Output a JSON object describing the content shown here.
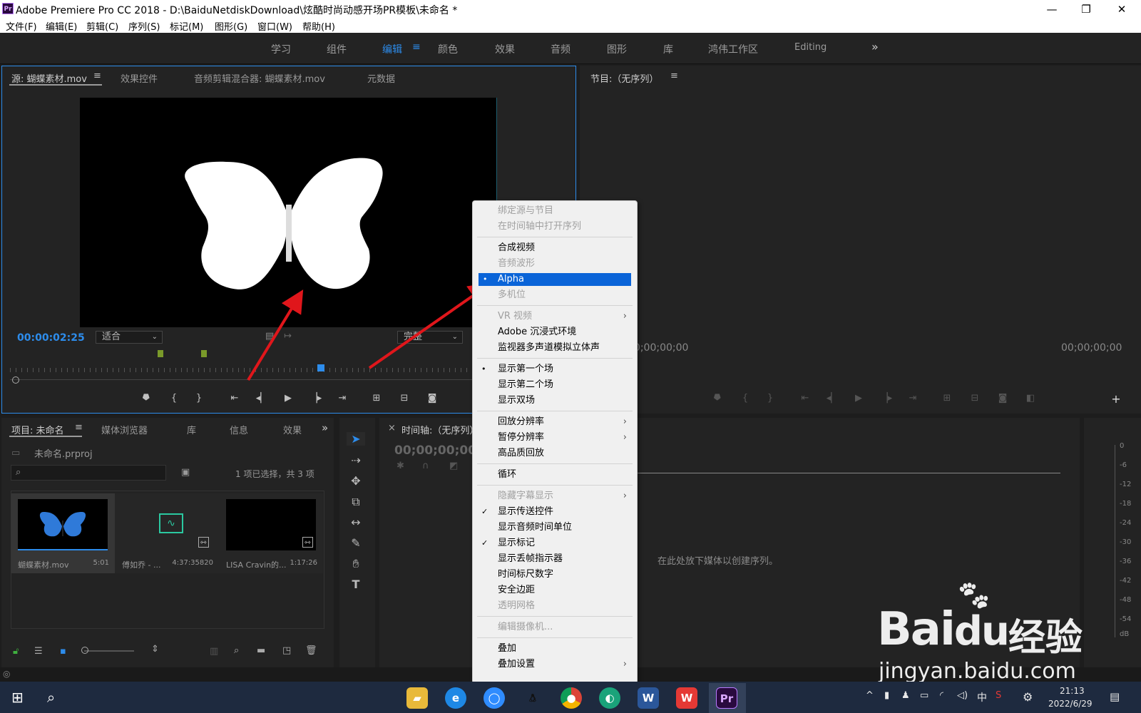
{
  "window": {
    "app_icon": "Pr",
    "title": "Adobe Premiere Pro CC 2018 - D:\\BaiduNetdiskDownload\\炫酷时尚动感开场PR模板\\未命名 *",
    "minimize": "—",
    "maximize": "❐",
    "close": "✕"
  },
  "menu": [
    "文件(F)",
    "编辑(E)",
    "剪辑(C)",
    "序列(S)",
    "标记(M)",
    "图形(G)",
    "窗口(W)",
    "帮助(H)"
  ],
  "workspaces": [
    "学习",
    "组件",
    "编辑",
    "颜色",
    "效果",
    "音频",
    "图形",
    "库",
    "鸿伟工作区",
    "Editing"
  ],
  "workspace_active": "编辑",
  "source_panel": {
    "tabs": [
      "源: 蝴蝶素材.mov",
      "效果控件",
      "音频剪辑混合器: 蝴蝶素材.mov",
      "元数据"
    ],
    "timecode": "00:00:02:25",
    "fit": "适合",
    "quality": "完整"
  },
  "program_panel": {
    "tab": "节目:（无序列）",
    "timecode_left": "00;00;00;00",
    "timecode_right": "00;00;00;00"
  },
  "context_menu": {
    "items": [
      {
        "label": "绑定源与节目",
        "disabled": true
      },
      {
        "label": "在时间轴中打开序列",
        "disabled": true
      },
      {
        "sep": true
      },
      {
        "label": "合成视频"
      },
      {
        "label": "音频波形",
        "disabled": true
      },
      {
        "label": "Alpha",
        "highlight": true,
        "mark": "•"
      },
      {
        "label": "多机位",
        "disabled": true
      },
      {
        "sep": true
      },
      {
        "label": "VR 视频",
        "disabled": true,
        "submenu": "›"
      },
      {
        "label": "Adobe 沉浸式环境"
      },
      {
        "label": "监视器多声道模拟立体声"
      },
      {
        "sep": true
      },
      {
        "label": "显示第一个场",
        "mark": "•"
      },
      {
        "label": "显示第二个场"
      },
      {
        "label": "显示双场"
      },
      {
        "sep": true
      },
      {
        "label": "回放分辨率",
        "submenu": "›"
      },
      {
        "label": "暂停分辨率",
        "submenu": "›"
      },
      {
        "label": "高品质回放"
      },
      {
        "sep": true
      },
      {
        "label": "循环"
      },
      {
        "sep": true
      },
      {
        "label": "隐藏字幕显示",
        "disabled": true,
        "submenu": "›"
      },
      {
        "label": "显示传送控件",
        "mark": "✓"
      },
      {
        "label": "显示音频时间单位"
      },
      {
        "label": "显示标记",
        "mark": "✓"
      },
      {
        "label": "显示丢帧指示器"
      },
      {
        "label": "时间标尺数字"
      },
      {
        "label": "安全边距"
      },
      {
        "label": "透明网格",
        "disabled": true
      },
      {
        "sep": true
      },
      {
        "label": "编辑摄像机...",
        "disabled": true
      },
      {
        "sep": true
      },
      {
        "label": "叠加"
      },
      {
        "label": "叠加设置",
        "submenu": "›"
      }
    ]
  },
  "project_panel": {
    "tabs": [
      "项目: 未命名",
      "媒体浏览器",
      "库",
      "信息",
      "效果"
    ],
    "project_file": "未命名.prproj",
    "selection_info": "1 项已选择，共 3 项",
    "items": [
      {
        "name": "蝴蝶素材.mov",
        "duration": "5:01"
      },
      {
        "name": "傅如乔 - ...",
        "duration": "4:37:35820"
      },
      {
        "name": "LISA Cravin的...",
        "duration": "1:17:26"
      }
    ]
  },
  "timeline_panel": {
    "tab": "时间轴:（无序列）",
    "close": "×",
    "timecode": "00;00;00;00",
    "empty_message": "在此处放下媒体以创建序列。"
  },
  "meter": {
    "labels": [
      "0",
      "-6",
      "-12",
      "-18",
      "-24",
      "-30",
      "-36",
      "-42",
      "-48",
      "-54",
      "dB"
    ]
  },
  "watermark": {
    "main": "Bai",
    "mid": "du",
    "cn": "经验",
    "url": "jingyan.baidu.com"
  },
  "taskbar": {
    "clock": "21:13",
    "date": "2022/6/29",
    "ime": "中"
  },
  "colors": {
    "accent": "#2d8ceb",
    "menu_highlight": "#0a64d8",
    "panel": "#232323",
    "arrow": "#e0161b"
  }
}
